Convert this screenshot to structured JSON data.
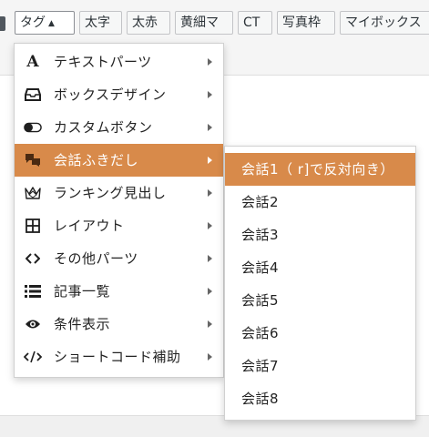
{
  "toolbar": {
    "buttons": [
      {
        "label": "タグ",
        "dropdown": true
      },
      {
        "label": "太字"
      },
      {
        "label": "太赤"
      },
      {
        "label": "黄細マ"
      },
      {
        "label": "CT"
      },
      {
        "label": "写真枠"
      },
      {
        "label": "マイボックス"
      }
    ]
  },
  "menu": {
    "items": [
      {
        "label": "テキストパーツ",
        "icon": "letter-a-icon"
      },
      {
        "label": "ボックスデザイン",
        "icon": "inbox-tray-icon"
      },
      {
        "label": "カスタムボタン",
        "icon": "toggle-icon"
      },
      {
        "label": "会話ふきだし",
        "icon": "speech-bubbles-icon",
        "highlighted": true
      },
      {
        "label": "ランキング見出し",
        "icon": "crown-icon"
      },
      {
        "label": "レイアウト",
        "icon": "grid-layout-icon"
      },
      {
        "label": "その他パーツ",
        "icon": "angle-brackets-icon"
      },
      {
        "label": "記事一覧",
        "icon": "list-icon"
      },
      {
        "label": "条件表示",
        "icon": "eye-icon"
      },
      {
        "label": "ショートコード補助",
        "icon": "code-slash-icon"
      }
    ]
  },
  "submenu": {
    "items": [
      {
        "label": "会話1（ r]で反対向き）",
        "highlighted": true
      },
      {
        "label": "会話2"
      },
      {
        "label": "会話3"
      },
      {
        "label": "会話4"
      },
      {
        "label": "会話5"
      },
      {
        "label": "会話6"
      },
      {
        "label": "会話7"
      },
      {
        "label": "会話8"
      }
    ]
  },
  "colors": {
    "highlight": "#d88a4a",
    "menu_bg": "#ffffff",
    "toolbar_button_bg": "#f6f7f7",
    "toolbar_button_border": "#c3c4c7"
  }
}
